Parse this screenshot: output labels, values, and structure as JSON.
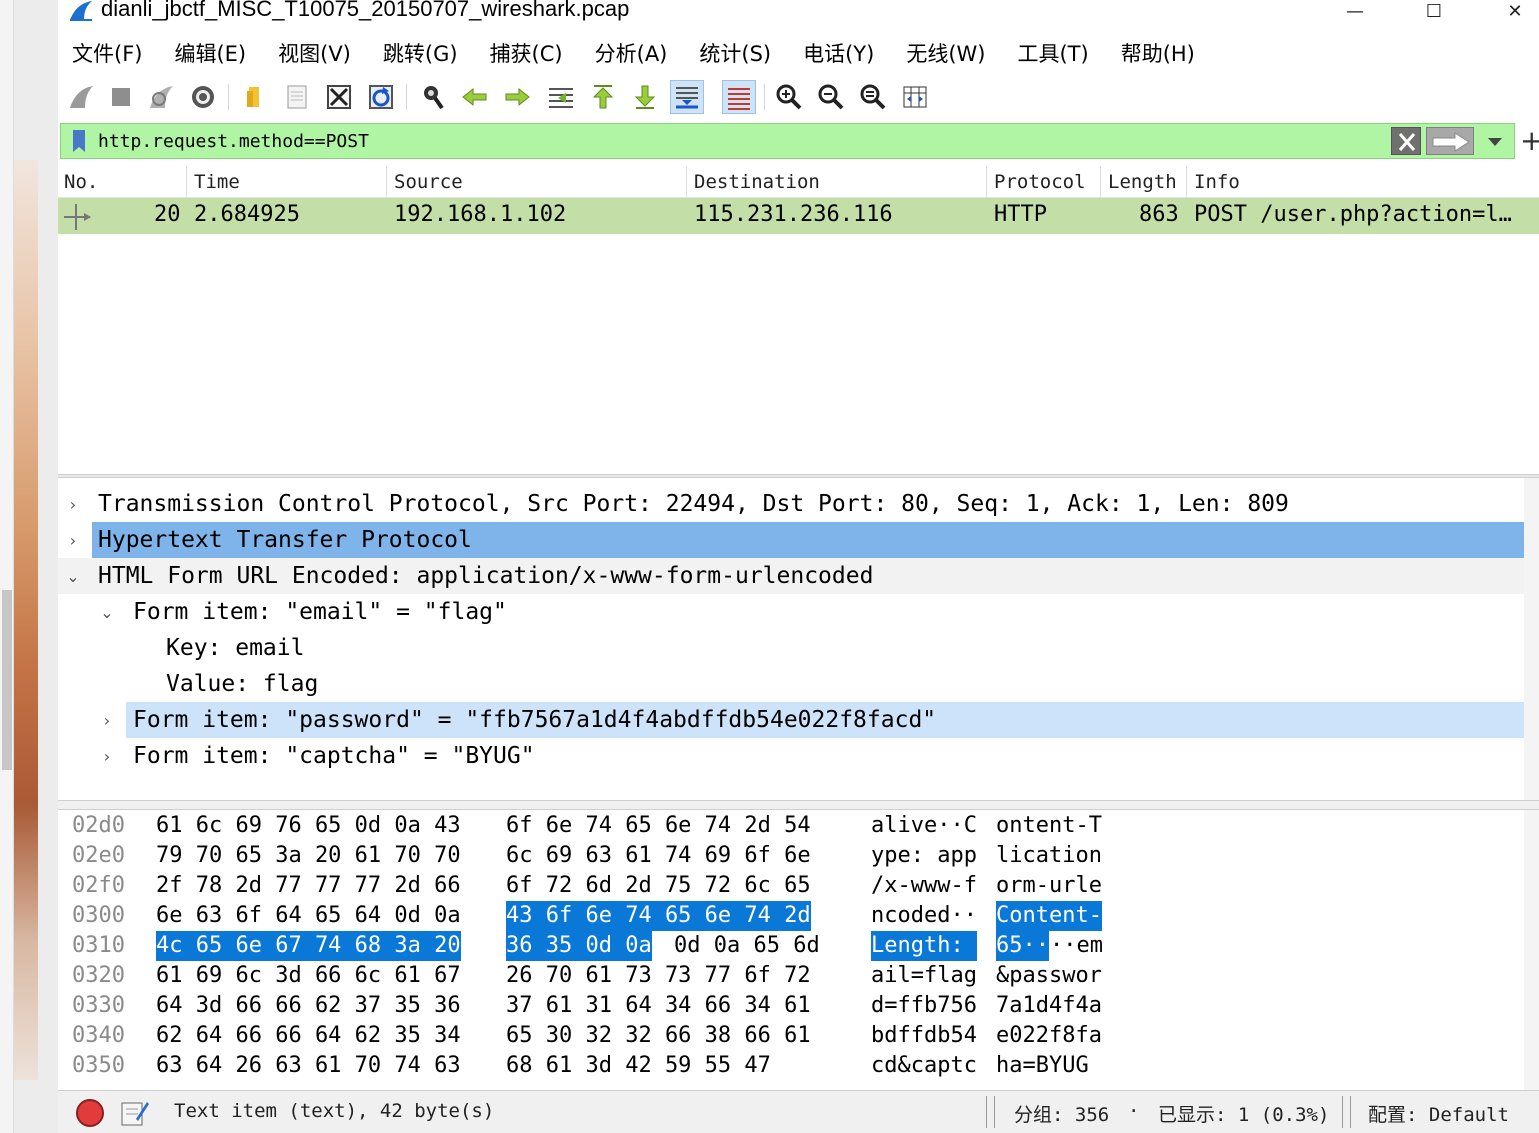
{
  "window": {
    "title": "dianli_jbctf_MISC_T10075_20150707_wireshark.pcap",
    "minimize_glyph": "—",
    "maximize_glyph": "☐",
    "close_glyph": "✕"
  },
  "menu": [
    {
      "label": "文件(F)"
    },
    {
      "label": "编辑(E)"
    },
    {
      "label": "视图(V)"
    },
    {
      "label": "跳转(G)"
    },
    {
      "label": "捕获(C)"
    },
    {
      "label": "分析(A)"
    },
    {
      "label": "统计(S)"
    },
    {
      "label": "电话(Y)"
    },
    {
      "label": "无线(W)"
    },
    {
      "label": "工具(T)"
    },
    {
      "label": "帮助(H)"
    }
  ],
  "toolbar": {
    "icons": [
      "shark-fin-start-icon",
      "stop-capture-icon",
      "restart-capture-icon",
      "capture-options-icon",
      "open-file-icon",
      "save-file-icon",
      "close-file-icon",
      "reload-file-icon",
      "find-packet-icon",
      "go-back-icon",
      "go-forward-icon",
      "go-to-packet-icon",
      "go-first-icon",
      "go-last-icon",
      "autoscroll-icon",
      "colorize-icon",
      "zoom-in-icon",
      "zoom-out-icon",
      "zoom-normal-icon",
      "resize-columns-icon"
    ],
    "active": [
      "autoscroll-icon",
      "colorize-icon"
    ]
  },
  "filter": {
    "value": "http.request.method==POST",
    "plus_glyph": "+",
    "bar_color": "#aff5a4"
  },
  "packet_list": {
    "columns": [
      "No.",
      "Time",
      "Source",
      "Destination",
      "Protocol",
      "Length",
      "Info"
    ],
    "rows": [
      {
        "no": "20",
        "time": "2.684925",
        "source": "192.168.1.102",
        "destination": "115.231.236.116",
        "protocol": "HTTP",
        "length": "863",
        "info": "POST /user.php?action=l…"
      }
    ],
    "row_color": "#c4dea8"
  },
  "details": [
    {
      "text": "Transmission Control Protocol, Src Port: 22494, Dst Port: 80, Seq: 1, Ack: 1, Len: 809",
      "arrow": "›"
    },
    {
      "text": "Hypertext Transfer Protocol",
      "arrow": "›"
    },
    {
      "text": "HTML Form URL Encoded: application/x-www-form-urlencoded",
      "arrow": "⌄"
    },
    {
      "text": "Form item: \"email\" = \"flag\"",
      "arrow": "⌄"
    },
    {
      "text": "Key: email",
      "arrow": ""
    },
    {
      "text": "Value: flag",
      "arrow": ""
    },
    {
      "text": "Form item: \"password\" = \"ffb7567a1d4f4abdffdb54e022f8facd\"",
      "arrow": "›"
    },
    {
      "text": "Form item: \"captcha\" = \"BYUG\"",
      "arrow": "›"
    }
  ],
  "bytes": [
    {
      "off": "02d0",
      "h1": "61 6c 69 76 65 0d 0a 43",
      "h2": "6f 6e 74 65 6e 74 2d 54",
      "a1": "alive··C",
      "a2": "ontent-T"
    },
    {
      "off": "02e0",
      "h1": "79 70 65 3a 20 61 70 70",
      "h2": "6c 69 63 61 74 69 6f 6e",
      "a1": "ype: app",
      "a2": "lication"
    },
    {
      "off": "02f0",
      "h1": "2f 78 2d 77 77 77 2d 66",
      "h2": "6f 72 6d 2d 75 72 6c 65",
      "a1": "/x-www-f",
      "a2": "orm-urle"
    },
    {
      "off": "0300",
      "h1": "6e 63 6f 64 65 64 0d 0a",
      "h2": "43 6f 6e 74 65 6e 74 2d",
      "a1": "ncoded··",
      "a2": "Content-"
    },
    {
      "off": "0310",
      "h1": "4c 65 6e 67 74 68 3a 20",
      "h2a": "36 35 0d 0a",
      "h2b": "0d 0a 65 6d",
      "a1": "Length: ",
      "a2a": "65··",
      "a2b": "··em"
    },
    {
      "off": "0320",
      "h1": "61 69 6c 3d 66 6c 61 67",
      "h2": "26 70 61 73 73 77 6f 72",
      "a1": "ail=flag",
      "a2": "&passwor"
    },
    {
      "off": "0330",
      "h1": "64 3d 66 66 62 37 35 36",
      "h2": "37 61 31 64 34 66 34 61",
      "a1": "d=ffb756",
      "a2": "7a1d4f4a"
    },
    {
      "off": "0340",
      "h1": "62 64 66 66 64 62 35 34",
      "h2": "65 30 32 32 66 38 66 61",
      "a1": "bdffdb54",
      "a2": "e022f8fa"
    },
    {
      "off": "0350",
      "h1": "63 64 26 63 61 70 74 63",
      "h2": "68 61 3d 42 59 55 47",
      "a1": "cd&captc",
      "a2": "ha=BYUG"
    }
  ],
  "status": {
    "field_info": "Text item (text), 42 byte(s)",
    "packets": "分组: 356",
    "displayed": "已显示: 1 (0.3%)",
    "profile": "配置: Default",
    "bullet": "·"
  }
}
